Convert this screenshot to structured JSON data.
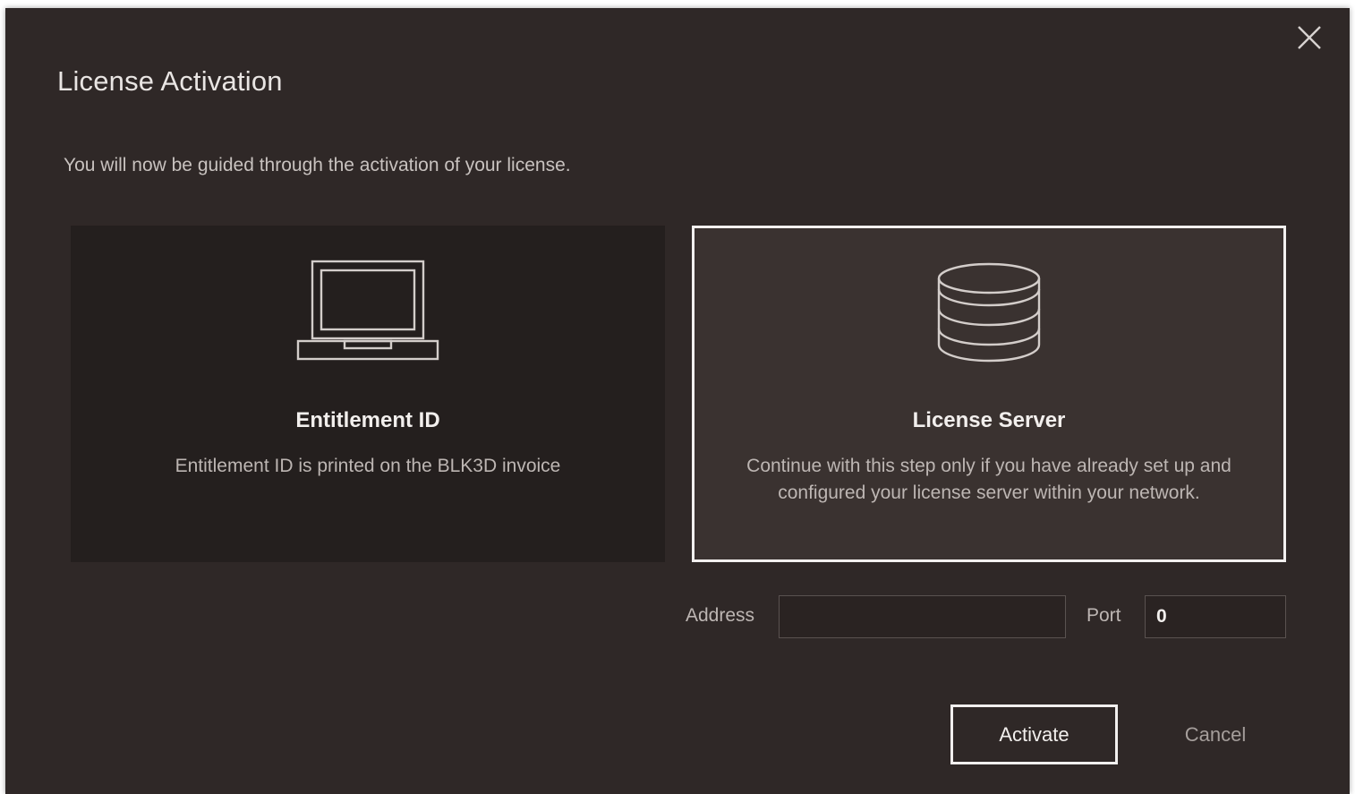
{
  "dialog": {
    "title": "License Activation",
    "subtitle": "You will now be guided through the activation of your license.",
    "close_icon": "close-icon"
  },
  "options": [
    {
      "id": "entitlement",
      "icon": "laptop-icon",
      "title": "Entitlement ID",
      "description": "Entitlement ID is printed on the BLK3D invoice",
      "selected": false
    },
    {
      "id": "license-server",
      "icon": "database-icon",
      "title": "License Server",
      "description": "Continue with this step only if you have already set up and configured your license server within your network.",
      "selected": true
    }
  ],
  "server_fields": {
    "address_label": "Address",
    "address_value": "",
    "port_label": "Port",
    "port_value": "0"
  },
  "actions": {
    "activate_label": "Activate",
    "cancel_label": "Cancel"
  },
  "colors": {
    "dialog_background": "#2f2827",
    "card_background": "#241f1e",
    "selected_card_background": "#3a3230",
    "selected_border": "#f2f0ef"
  }
}
